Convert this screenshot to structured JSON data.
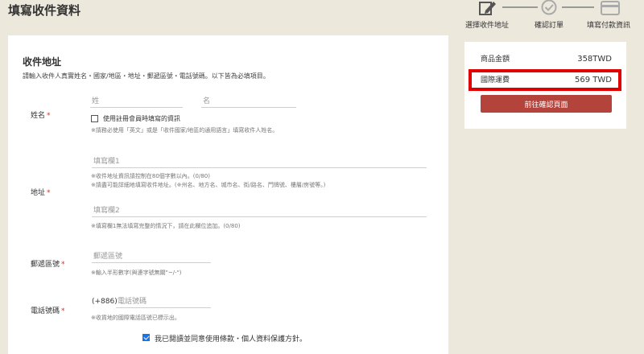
{
  "page": {
    "title": "填寫收件資料"
  },
  "steps": [
    {
      "label": "選擇收件地址",
      "icon": "pencil-icon",
      "state": "active"
    },
    {
      "label": "確認訂單",
      "icon": "check-circle-icon",
      "state": "inactive"
    },
    {
      "label": "填寫付款資訊",
      "icon": "credit-card-icon",
      "state": "inactive"
    }
  ],
  "form": {
    "title": "收件地址",
    "description": "請輸入收件人真實姓名・國家/地區・地址・郵遞區號・電話號碼。以下皆為必填項目。",
    "required_mark": "*",
    "name": {
      "label": "姓名",
      "last_placeholder": "姓",
      "first_placeholder": "名",
      "use_member_info": "使用註冊會員時填寫的資訊",
      "hint": "※請務必使用「英文」或是「收件國家/地區的通用語言」填寫收件人姓名。"
    },
    "address": {
      "label": "地址",
      "line1_placeholder": "填寫欄1",
      "hint1": "※收件地址資訊請控制在80個字數以內。(0/80)",
      "hint2": "※請盡可能詳細地填寫收件地址。(※州名、地方名、城市名、街/路名、門牌號、樓層/房號等。)",
      "line2_placeholder": "填寫欄2",
      "hint3": "※填寫欄1無法填寫完整的情況下，請在此欄位追加。(0/80)"
    },
    "postal": {
      "label": "郵遞區號",
      "placeholder": "郵遞區號",
      "hint": "※輸入半形數字(與連字號無關\"~/-\")"
    },
    "phone": {
      "label": "電話號碼",
      "prefix": "(+886)",
      "placeholder": "電話號碼",
      "hint": "※收貨地的國際電話區號已標示出。"
    },
    "agree": {
      "label": "我已閱讀並同意使用條款・個人資料保護方針。",
      "checked": true
    }
  },
  "summary": {
    "subtotal_label": "商品金額",
    "subtotal_value": "358TWD",
    "shipping_label": "國際運費",
    "shipping_value": "569 TWD",
    "confirm_button": "前往確認頁面"
  },
  "colors": {
    "accent": "#b3433b",
    "highlight": "#e00000",
    "background": "#ece8dc"
  }
}
